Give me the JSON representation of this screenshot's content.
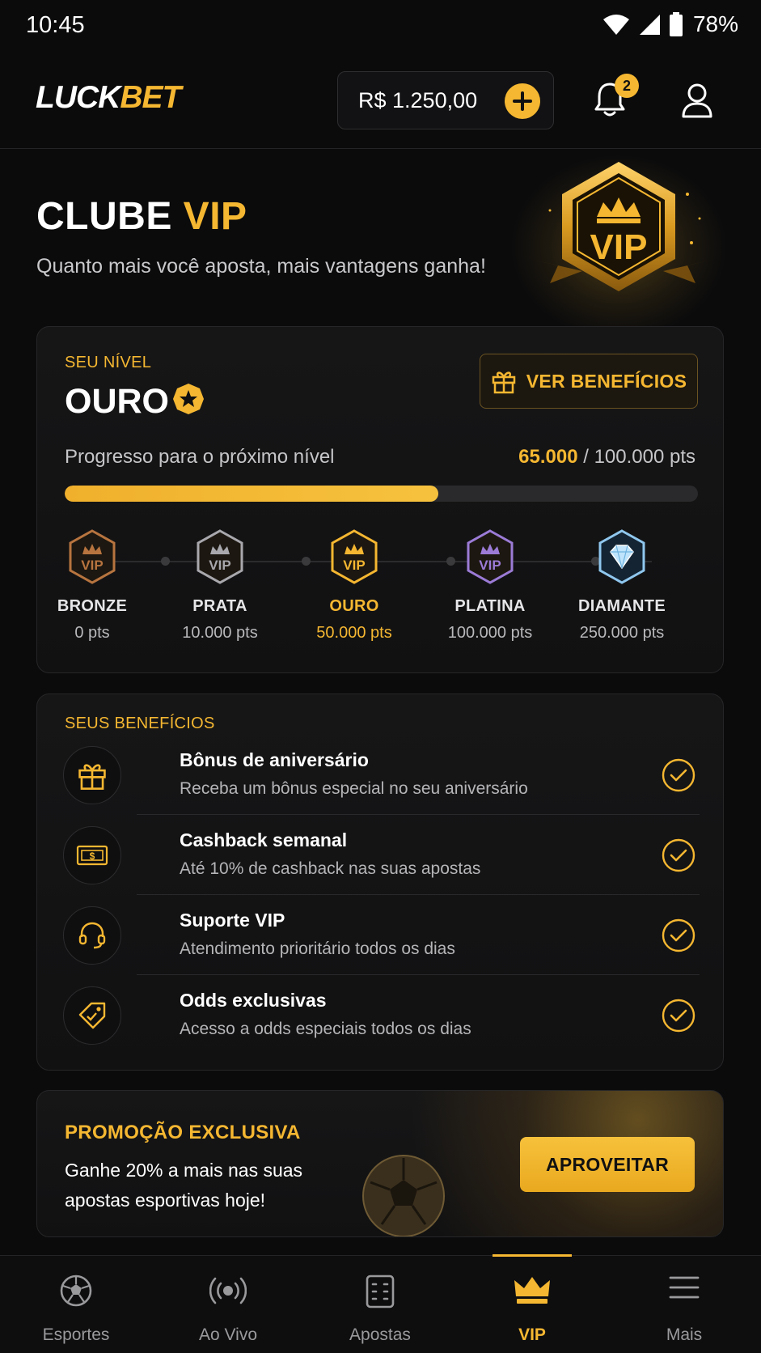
{
  "status_bar": {
    "time": "10:45",
    "battery": "78%"
  },
  "header": {
    "logo_part1": "LUCK",
    "logo_part2": "BET",
    "balance": "R$ 1.250,00",
    "notification_count": "2"
  },
  "hero": {
    "title_part1": "CLUBE",
    "title_part2": "VIP",
    "subtitle": "Quanto mais você aposta, mais vantagens ganha!",
    "emblem_text": "VIP"
  },
  "level_card": {
    "label": "SEU NÍVEL",
    "level": "OURO",
    "benefits_button": "VER BENEFÍCIOS",
    "progress_label": "Progresso para o próximo nível",
    "progress_current": "65.000",
    "progress_separator": " / ",
    "progress_total": "100.000 pts",
    "progress_fraction": 0.59,
    "tiers": [
      {
        "name": "BRONZE",
        "pts": "0 pts",
        "badge": "VIP",
        "color": "#b7743f"
      },
      {
        "name": "PRATA",
        "pts": "10.000 pts",
        "badge": "VIP",
        "color": "#a8a8ad"
      },
      {
        "name": "OURO",
        "pts": "50.000 pts",
        "badge": "VIP",
        "color": "#f5b731"
      },
      {
        "name": "PLATINA",
        "pts": "100.000 pts",
        "badge": "VIP",
        "color": "#9b7bd6"
      },
      {
        "name": "DIAMANTE",
        "pts": "250.000 pts",
        "badge": "",
        "color": "#8fc7ee"
      }
    ]
  },
  "benefits_card": {
    "label": "SEUS BENEFÍCIOS",
    "items": [
      {
        "title": "Bônus de aniversário",
        "desc": "Receba um bônus especial no seu aniversário",
        "icon": "gift-icon"
      },
      {
        "title": "Cashback semanal",
        "desc": "Até 10% de cashback nas suas apostas",
        "icon": "cash-icon"
      },
      {
        "title": "Suporte VIP",
        "desc": "Atendimento prioritário todos os dias",
        "icon": "headset-icon"
      },
      {
        "title": "Odds exclusivas",
        "desc": "Acesso a odds especiais todos os dias",
        "icon": "tag-icon"
      }
    ]
  },
  "promo": {
    "title": "PROMOÇÃO EXCLUSIVA",
    "text": "Ganhe 20% a mais nas suas apostas esportivas hoje!",
    "button": "APROVEITAR"
  },
  "bottom_nav": {
    "items": [
      {
        "label": "Esportes",
        "icon": "soccer-ball-icon"
      },
      {
        "label": "Ao Vivo",
        "icon": "live-broadcast-icon"
      },
      {
        "label": "Apostas",
        "icon": "bet-slip-icon"
      },
      {
        "label": "VIP",
        "icon": "crown-icon"
      },
      {
        "label": "Mais",
        "icon": "menu-icon"
      }
    ],
    "active_index": 3
  },
  "colors": {
    "accent": "#f5b731",
    "background": "#0b0b0c",
    "card": "#151516"
  }
}
